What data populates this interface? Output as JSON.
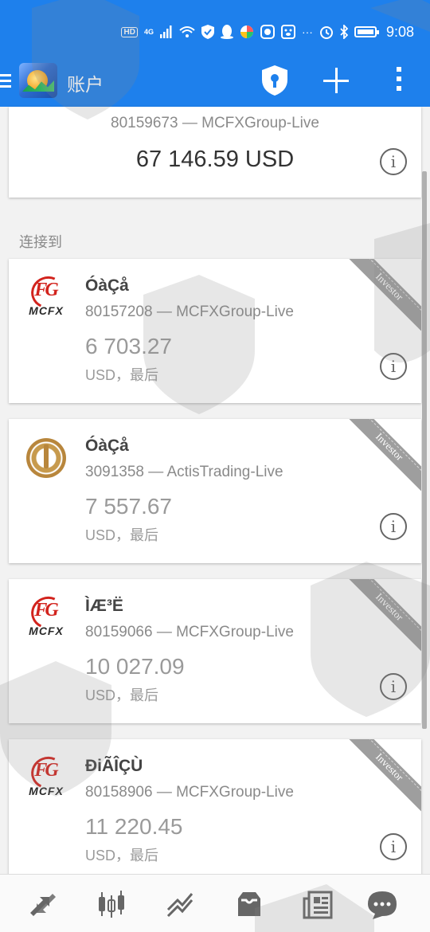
{
  "status_bar": {
    "network_badge": "HD",
    "signal_label": "4G",
    "time": "9:08"
  },
  "app_bar": {
    "title": "账户"
  },
  "current_account": {
    "account_line": "80159673 — MCFXGroup-Live",
    "balance": "67 146.59 USD"
  },
  "section_label": "连接到",
  "accounts": [
    {
      "logo": "mcfx-logo",
      "logo_text": "MCFX",
      "name": "ÓàÇå",
      "server_line": "80157208 — MCFXGroup-Live",
      "balance": "6 703.27",
      "currency_line": "USD，最后",
      "badge": "Investor"
    },
    {
      "logo": "actis-logo",
      "name": "ÓàÇå",
      "server_line": "3091358 — ActisTrading-Live",
      "balance": "7 557.67",
      "currency_line": "USD，最后",
      "badge": "Investor"
    },
    {
      "logo": "mcfx-logo",
      "logo_text": "MCFX",
      "name": "ÌÆ³Ë",
      "server_line": "80159066 — MCFXGroup-Live",
      "balance": "10 027.09",
      "currency_line": "USD，最后",
      "badge": "Investor"
    },
    {
      "logo": "mcfx-logo",
      "logo_text": "MCFX",
      "name": "ÐiÃÎÇÙ",
      "server_line": "80158906 — MCFXGroup-Live",
      "balance": "11 220.45",
      "currency_line": "USD，最后",
      "badge": "Investor"
    }
  ],
  "bottom_nav": [
    {
      "icon": "quotes-icon"
    },
    {
      "icon": "chart-icon"
    },
    {
      "icon": "trade-icon"
    },
    {
      "icon": "history-icon"
    },
    {
      "icon": "news-icon"
    },
    {
      "icon": "chat-icon"
    }
  ],
  "colors": {
    "primary": "#1e80ec",
    "logo_red": "#d2231d",
    "badge_gray": "#9e9e9e"
  }
}
